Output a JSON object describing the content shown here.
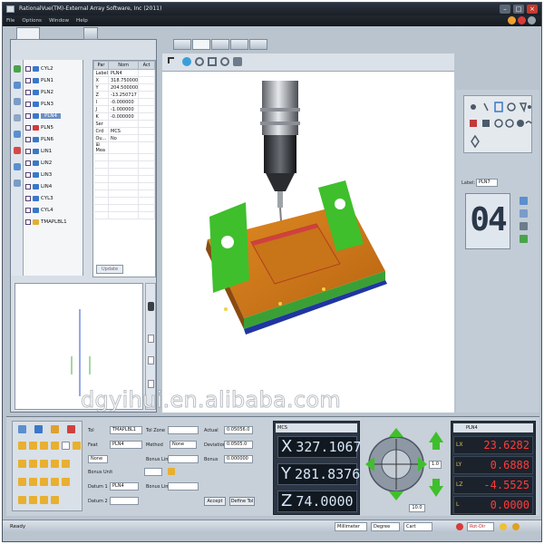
{
  "window": {
    "title": "RationalVue(TM)-External Array Software, Inc (2011)",
    "menu": [
      "File",
      "Options",
      "Window",
      "Help"
    ]
  },
  "tree": {
    "items": [
      {
        "label": "CYL2",
        "color": "#3a78c8"
      },
      {
        "label": "PLN1",
        "color": "#3a78c8"
      },
      {
        "label": "PLN2",
        "color": "#3a78c8"
      },
      {
        "label": "PLN3",
        "color": "#3a78c8"
      },
      {
        "label": "PLN4",
        "color": "#3a78c8",
        "selected": true
      },
      {
        "label": "PLN5",
        "color": "#d23a3a"
      },
      {
        "label": "PLN6",
        "color": "#3a78c8"
      },
      {
        "label": "LIN1",
        "color": "#3a78c8"
      },
      {
        "label": "LIN2",
        "color": "#3a78c8"
      },
      {
        "label": "LIN3",
        "color": "#3a78c8"
      },
      {
        "label": "LIN4",
        "color": "#3a78c8"
      },
      {
        "label": "CYL3",
        "color": "#3a78c8"
      },
      {
        "label": "CYL4",
        "color": "#3a78c8"
      },
      {
        "label": "TMAPLBL1",
        "color": "#e0b030"
      }
    ]
  },
  "props": {
    "headers": [
      "Par",
      "Nom",
      "Act"
    ],
    "rows": [
      [
        "Label",
        "PLN4",
        ""
      ],
      [
        "X",
        "318.750000",
        ""
      ],
      [
        "Y",
        "204.500000",
        ""
      ],
      [
        "Z",
        "-13.250717",
        ""
      ],
      [
        "I",
        "-0.000000",
        ""
      ],
      [
        "J",
        "-1.000000",
        ""
      ],
      [
        "K",
        "-0.000000",
        ""
      ],
      [
        "Ser",
        "",
        ""
      ],
      [
        "Crd",
        "MCS",
        ""
      ],
      [
        "Ou...",
        "No",
        ""
      ],
      [
        "⊞ Mea",
        "",
        ""
      ],
      [
        "",
        "",
        ""
      ],
      [
        "",
        "",
        ""
      ],
      [
        "",
        "",
        ""
      ],
      [
        "",
        "",
        ""
      ],
      [
        "",
        "",
        ""
      ],
      [
        "",
        "",
        ""
      ],
      [
        "",
        "",
        ""
      ],
      [
        "",
        "",
        ""
      ],
      [
        "",
        "",
        ""
      ]
    ],
    "update_label": "Update"
  },
  "right_panel": {
    "label_text": "Label:",
    "label_value": "PLN7",
    "feature_id": "04"
  },
  "form": {
    "tol_label": "Tol",
    "tol_value": "TMAPLBL1",
    "tol_zone_label": "Tol Zone",
    "actual_label": "Actual",
    "actual_value": "0.05056.0",
    "feat_label": "Feat",
    "feat_value": "PLN4",
    "method_label": "Method",
    "method_value": "None",
    "deviation_label": "Deviation",
    "deviation_value": "0.0505.0",
    "none_label": "None",
    "bonus_limit1_label": "Bonus Limit1",
    "bonus_label": "Bonus",
    "bonus_value": "0.000000",
    "bonus_unit_label": "Bonus Unit",
    "datum1_label": "Datum 1",
    "datum1_value": "PLN4",
    "datum2_label": "Datum 2",
    "bonus_limit2_label": "Bonus Limit2",
    "accept_label": "Accept",
    "define_tol_label": "Define Tol"
  },
  "dro": {
    "coord_system": "MCS",
    "axes": [
      {
        "axis": "X",
        "value": "327.1067"
      },
      {
        "axis": "Y",
        "value": "281.8376"
      },
      {
        "axis": "Z",
        "value": "74.0000"
      }
    ]
  },
  "jog": {
    "step_value": "1.0",
    "speed_value": "10.0"
  },
  "results": {
    "feature": "PLN4",
    "rows": [
      {
        "label": "LX",
        "value": "23.6282"
      },
      {
        "label": "LY",
        "value": "0.6888"
      },
      {
        "label": "LZ",
        "value": "-4.5525"
      },
      {
        "label": "L",
        "value": "0.0000"
      }
    ]
  },
  "statusbar": {
    "status": "Ready",
    "unit": "Millimeter",
    "angle": "Degree",
    "coord": "Cart",
    "mode": "Rot-Dir"
  },
  "watermark": "dgyihui.en.alibaba.com",
  "colors": {
    "accent": "#3a78c8",
    "part_orange": "#d5801a",
    "part_green": "#3fbf2c",
    "readout_red": "#ff3b3b"
  }
}
